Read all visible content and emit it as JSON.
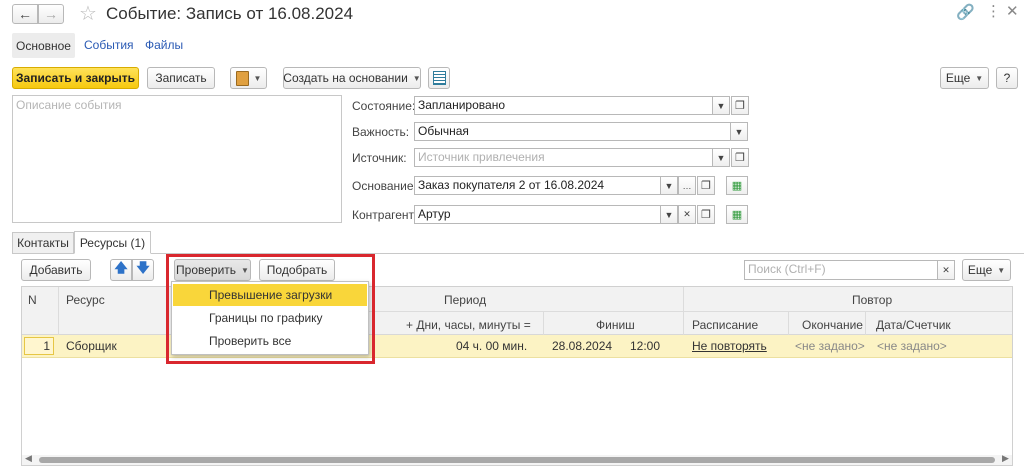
{
  "window": {
    "title": "Событие: Запись от 16.08.2024"
  },
  "nav_tabs": [
    "Основное",
    "События",
    "Файлы"
  ],
  "toolbar": {
    "save_close": "Записать и закрыть",
    "save": "Записать",
    "create_based": "Создать на основании",
    "more": "Еще",
    "help": "?"
  },
  "form": {
    "description_placeholder": "Описание события",
    "state_label": "Состояние:",
    "state_value": "Запланировано",
    "importance_label": "Важность:",
    "importance_value": "Обычная",
    "source_label": "Источник:",
    "source_placeholder": "Источник привлечения",
    "basis_label": "Основание:",
    "basis_value": "Заказ покупателя 2 от 16.08.2024",
    "counterparty_label": "Контрагент:",
    "counterparty_value": "Артур"
  },
  "inner_tabs": [
    "Контакты",
    "Ресурсы (1)"
  ],
  "resources_toolbar": {
    "add": "Добавить",
    "check": "Проверить",
    "pick": "Подобрать",
    "search_placeholder": "Поиск (Ctrl+F)",
    "more": "Еще"
  },
  "check_menu": [
    "Превышение загрузки",
    "Границы по графику",
    "Проверить все"
  ],
  "table": {
    "headers": {
      "n": "N",
      "resource": "Ресурс",
      "period": "Период",
      "duration": "+ Дни, часы, минуты =",
      "finish": "Финиш",
      "repeat": "Повтор",
      "schedule": "Расписание",
      "end": "Окончание",
      "date_counter": "Дата/Счетчик"
    },
    "rows": [
      {
        "n": "1",
        "resource": "Сборщик",
        "duration": "04 ч. 00 мин.",
        "finish_date": "28.08.2024",
        "finish_time": "12:00",
        "schedule": "Не повторять",
        "end": "<не задано>",
        "date_counter": "<не задано>"
      }
    ]
  },
  "colors": {
    "accent_yellow": "#f6c90f",
    "highlight_row": "#fcf3c4",
    "menu_highlight": "#f9d63a",
    "annotation_red": "#d9272e",
    "link_blue": "#2a5ab4"
  }
}
